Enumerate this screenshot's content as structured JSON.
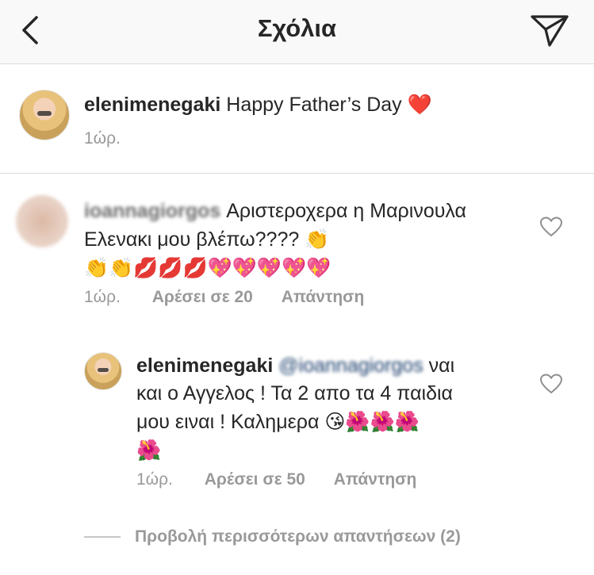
{
  "header": {
    "title": "Σχόλια"
  },
  "caption": {
    "username": "elenimenegaki",
    "text": "Happy Father’s Day",
    "emoji": "❤️",
    "time": "1ώρ."
  },
  "comments": [
    {
      "username": "ioannagiorgos",
      "text": "Αριστεροχερα η Μαρινουλα Ελενακι μου βλέπω????",
      "emoji_line1": "👏",
      "emoji_line2": "👏👏💋💋💋💖💖💖💖💖",
      "time": "1ώρ.",
      "likes": "Αρέσει σε 20",
      "reply": "Απάντηση"
    }
  ],
  "replies": [
    {
      "username": "elenimenegaki",
      "mention": "@ioannagiorgos",
      "text_line1_tail": "ναι",
      "text_line2": "και ο Αγγελος ! Τα 2 απο τα 4 παιδια",
      "text_line3": "μου ειναι ! Καλημερα",
      "emoji_line3": "😘🌺🌺🌺",
      "emoji_line4": "🌺",
      "time": "1ώρ.",
      "likes": "Αρέσει σε 50",
      "reply": "Απάντηση"
    }
  ],
  "view_more": {
    "label": "Προβολή περισσότερων απαντήσεων (2)"
  },
  "colors": {
    "text": "#262626",
    "meta": "#999999",
    "divider": "#dbdbdb",
    "header_bg": "#f9f9f9"
  }
}
